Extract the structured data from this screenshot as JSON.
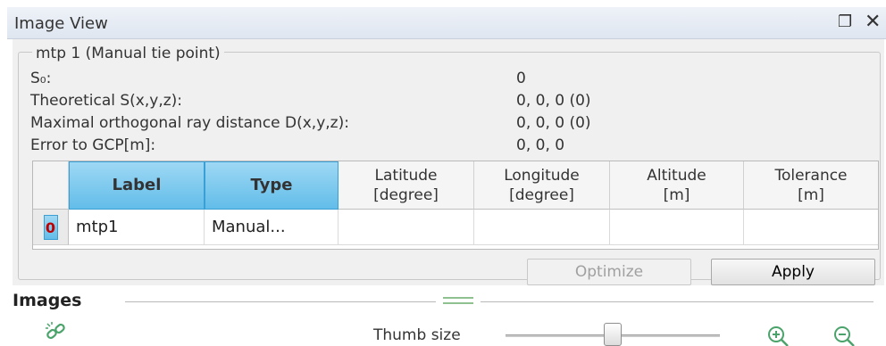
{
  "window": {
    "title": "Image View"
  },
  "group": {
    "title": "mtp 1 (Manual tie point)",
    "rows": [
      {
        "label": "S₀:",
        "value": "0"
      },
      {
        "label": "Theoretical S(x,y,z):",
        "value": "0, 0, 0 (0)"
      },
      {
        "label": "Maximal orthogonal ray distance D(x,y,z):",
        "value": "0, 0, 0 (0)"
      },
      {
        "label": "Error to GCP[m]:",
        "value": "0, 0, 0"
      }
    ]
  },
  "table": {
    "columns": [
      "Label",
      "Type",
      "Latitude\n[degree]",
      "Longitude\n[degree]",
      "Altitude\n[m]",
      "Tolerance\n[m]"
    ],
    "rows": [
      {
        "index": "0",
        "label": "mtp1",
        "type": "Manual...",
        "latitude": "",
        "longitude": "",
        "altitude": "",
        "tolerance": ""
      }
    ]
  },
  "buttons": {
    "optimize": "Optimize",
    "apply": "Apply"
  },
  "images": {
    "section_label": "Images",
    "thumb_label": "Thumb size",
    "thumb_size": 0.5
  },
  "icons": {
    "float": "float-icon",
    "close": "close-icon",
    "link": "link-icon",
    "zoom_in": "zoom-in-icon",
    "zoom_out": "zoom-out-icon"
  },
  "colors": {
    "selected_header": "#62bde9",
    "row_index": "#c00000",
    "icon_green": "#4aa36a"
  }
}
